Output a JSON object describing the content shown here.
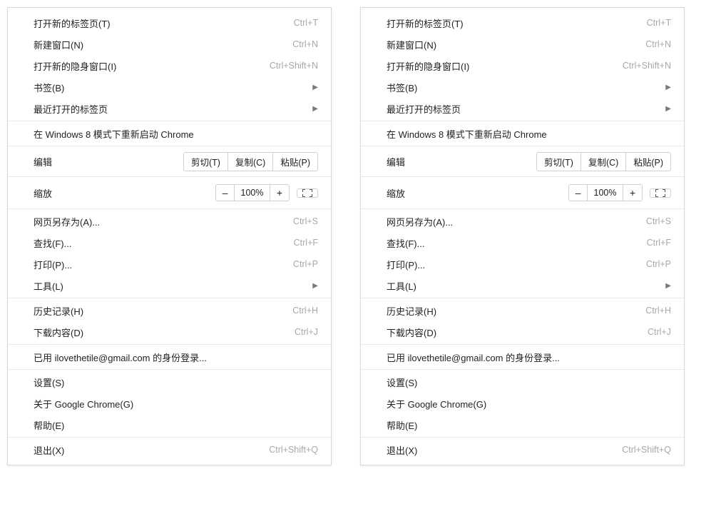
{
  "menu": {
    "s1": [
      {
        "label": "打开新的标签页(T)",
        "shortcut": "Ctrl+T",
        "submenu": false
      },
      {
        "label": "新建窗口(N)",
        "shortcut": "Ctrl+N",
        "submenu": false
      },
      {
        "label": "打开新的隐身窗口(I)",
        "shortcut": "Ctrl+Shift+N",
        "submenu": false
      },
      {
        "label": "书签(B)",
        "shortcut": "",
        "submenu": true
      },
      {
        "label": "最近打开的标签页",
        "shortcut": "",
        "submenu": true
      }
    ],
    "s2": [
      {
        "label": "在 Windows 8 模式下重新启动 Chrome",
        "shortcut": "",
        "submenu": false
      }
    ],
    "edit": {
      "label": "编辑",
      "cut": "剪切(T)",
      "copy": "复制(C)",
      "paste": "粘贴(P)"
    },
    "zoom": {
      "label": "缩放",
      "minus": "–",
      "value": "100%",
      "plus": "+"
    },
    "s3": [
      {
        "label": "网页另存为(A)...",
        "shortcut": "Ctrl+S",
        "submenu": false
      },
      {
        "label": "查找(F)...",
        "shortcut": "Ctrl+F",
        "submenu": false
      },
      {
        "label": "打印(P)...",
        "shortcut": "Ctrl+P",
        "submenu": false
      },
      {
        "label": "工具(L)",
        "shortcut": "",
        "submenu": true
      }
    ],
    "s4": [
      {
        "label": "历史记录(H)",
        "shortcut": "Ctrl+H",
        "submenu": false
      },
      {
        "label": "下载内容(D)",
        "shortcut": "Ctrl+J",
        "submenu": false
      }
    ],
    "s5": [
      {
        "label": "已用 ilovethetile@gmail.com 的身份登录...",
        "shortcut": "",
        "submenu": false
      }
    ],
    "s6": [
      {
        "label": "设置(S)",
        "shortcut": "",
        "submenu": false
      },
      {
        "label": "关于 Google Chrome(G)",
        "shortcut": "",
        "submenu": false
      },
      {
        "label": "帮助(E)",
        "shortcut": "",
        "submenu": false
      }
    ],
    "s7": [
      {
        "label": "退出(X)",
        "shortcut": "Ctrl+Shift+Q",
        "submenu": false
      }
    ]
  }
}
